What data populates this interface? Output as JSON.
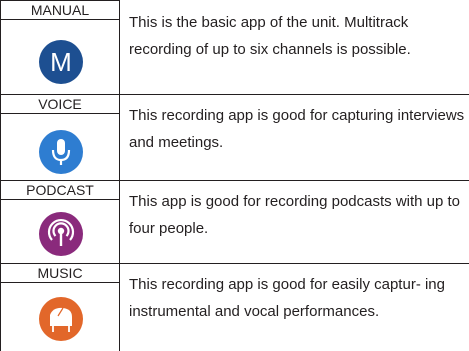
{
  "apps": [
    {
      "label": "MANUAL",
      "description": "This is the basic app of the unit. Multitrack recording of up to six channels is possible.",
      "icon": "letter-m-icon",
      "color": "#1d4f91"
    },
    {
      "label": "VOICE",
      "description": "This recording app is good for capturing interviews and meetings.",
      "icon": "microphone-icon",
      "color": "#2e7dd1"
    },
    {
      "label": "PODCAST",
      "description": "This app is good for recording podcasts with up to four people.",
      "icon": "podcast-broadcast-icon",
      "color": "#8a2a7c"
    },
    {
      "label": "MUSIC",
      "description": "This recording app is good for easily captur- ing instrumental and vocal performances.",
      "icon": "grand-piano-icon",
      "color": "#e2672a"
    }
  ]
}
